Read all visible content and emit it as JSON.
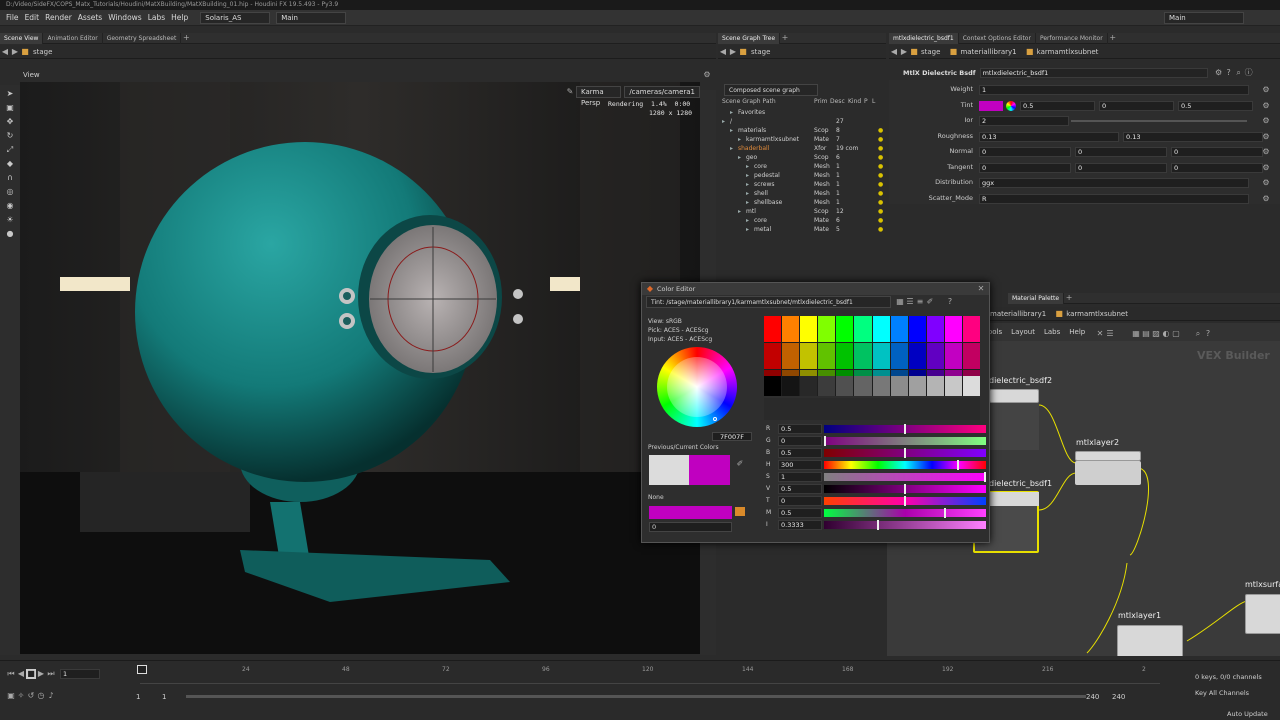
{
  "window": {
    "title": "D:/Video/SideFX/COPS_Matx_Tutorials/Houdini/MatXBuilding/MatXBuilding_01.hip - Houdini FX 19.5.493 - Py3.9"
  },
  "menu": [
    "File",
    "Edit",
    "Render",
    "Assets",
    "Windows",
    "Labs",
    "Help"
  ],
  "desktop": "Solaris_AS",
  "context": "Main",
  "top_right_context": "Main",
  "left_tabs": [
    "Scene View",
    "Animation Editor",
    "Geometry Spreadsheet"
  ],
  "left_path": "stage",
  "viewport": {
    "label": "View",
    "camera_menu": "Karma Persp",
    "camera_path": "/cameras/camera1",
    "render_status": "Rendering  1.4%  0:00",
    "resolution": "1280 x 1280"
  },
  "tree_tabs": [
    "Scene Graph Tree"
  ],
  "tree_path": "stage",
  "tree": {
    "mode": "Composed scene graph",
    "columns": [
      "Scene Graph Path",
      "Prim",
      "Desc",
      "Kind",
      "P",
      "L"
    ],
    "rows": [
      {
        "name": "Favorites",
        "prim": "",
        "desc": "",
        "indent": 1
      },
      {
        "name": "/",
        "prim": "",
        "desc": "27",
        "indent": 0
      },
      {
        "name": "materials",
        "prim": "Scop",
        "desc": "8",
        "indent": 1
      },
      {
        "name": "karmamtlxsubnet",
        "prim": "Mate",
        "desc": "7",
        "indent": 2
      },
      {
        "name": "shaderball",
        "prim": "Xfor",
        "desc": "19 com",
        "indent": 1,
        "color": "#e08a3a"
      },
      {
        "name": "geo",
        "prim": "Scop",
        "desc": "6",
        "indent": 2
      },
      {
        "name": "core",
        "prim": "Mesh",
        "desc": "1",
        "indent": 3
      },
      {
        "name": "pedestal",
        "prim": "Mesh",
        "desc": "1",
        "indent": 3
      },
      {
        "name": "screws",
        "prim": "Mesh",
        "desc": "1",
        "indent": 3
      },
      {
        "name": "shell",
        "prim": "Mesh",
        "desc": "1",
        "indent": 3
      },
      {
        "name": "shellbase",
        "prim": "Mesh",
        "desc": "1",
        "indent": 3
      },
      {
        "name": "mtl",
        "prim": "Scop",
        "desc": "12",
        "indent": 2
      },
      {
        "name": "core",
        "prim": "Mate",
        "desc": "6",
        "indent": 3
      },
      {
        "name": "metal",
        "prim": "Mate",
        "desc": "5",
        "indent": 3
      }
    ]
  },
  "param_tabs": [
    "mtlxdielectric_bsdf1",
    "Context Options Editor",
    "Performance Monitor"
  ],
  "param_path": [
    "stage",
    "materiallibrary1",
    "karmamtlxsubnet"
  ],
  "params": {
    "node_type": "MtlX Dielectric Bsdf",
    "node_name": "mtlxdielectric_bsdf1",
    "rows": [
      {
        "label": "Weight",
        "values": [
          "1"
        ]
      },
      {
        "label": "Tint",
        "values": [
          "0.5",
          "0",
          "0.5"
        ],
        "color": "#c000c0"
      },
      {
        "label": "Ior",
        "values": [
          "2"
        ]
      },
      {
        "label": "Roughness",
        "values": [
          "0.13",
          "0.13"
        ]
      },
      {
        "label": "Normal",
        "values": [
          "0",
          "0",
          "0"
        ]
      },
      {
        "label": "Tangent",
        "values": [
          "0",
          "0",
          "0"
        ]
      },
      {
        "label": "Distribution",
        "values": [
          "ggx"
        ]
      },
      {
        "label": "Scatter_Mode",
        "values": [
          "R"
        ]
      }
    ]
  },
  "color_editor": {
    "title": "Color Editor",
    "path": "Tint: /stage/materiallibrary1/karmamtlxsubnet/mtlxdielectric_bsdf1",
    "view": "View:  sRGB",
    "pick": "Pick:  ACES - ACEScg",
    "input": "Input:  ACES - ACEScg",
    "hex": "7F007F",
    "prev_label": "Previous/Current Colors",
    "none_label": "None",
    "alpha_value": "0",
    "sliders": [
      {
        "key": "R",
        "value": "0.5",
        "pos": 0.5
      },
      {
        "key": "G",
        "value": "0",
        "pos": 0.0
      },
      {
        "key": "B",
        "value": "0.5",
        "pos": 0.5
      },
      {
        "key": "H",
        "value": "300",
        "pos": 0.83
      },
      {
        "key": "S",
        "value": "1",
        "pos": 1.0
      },
      {
        "key": "V",
        "value": "0.5",
        "pos": 0.5
      },
      {
        "key": "T",
        "value": "0",
        "pos": 0.5
      },
      {
        "key": "M",
        "value": "0.5",
        "pos": 0.75
      },
      {
        "key": "I",
        "value": "0.3333",
        "pos": 0.33
      }
    ],
    "current_color": "#c000c0",
    "previous_color": "#dcdcdc"
  },
  "network": {
    "tabs": [
      "Material Palette"
    ],
    "path": [
      "materiallibrary1",
      "karmamtlxsubnet"
    ],
    "menu": [
      "ools",
      "Layout",
      "Labs",
      "Help"
    ],
    "watermark": "VEX Builder",
    "nodes": [
      "dielectric_bsdf2",
      "mtlxlayer2",
      "dielectric_bsdf1",
      "mtlxlayer1",
      "mtlxsurfa"
    ]
  },
  "timeline": {
    "frame": "1",
    "start": "1",
    "start2": "1",
    "end": "240",
    "end2": "240",
    "ticks": [
      "1",
      "24",
      "48",
      "72",
      "96",
      "120",
      "144",
      "168",
      "192",
      "216",
      "2"
    ],
    "keys_label": "0 keys, 0/0 channels",
    "key_all": "Key All Channels",
    "auto_update": "Auto Update"
  }
}
